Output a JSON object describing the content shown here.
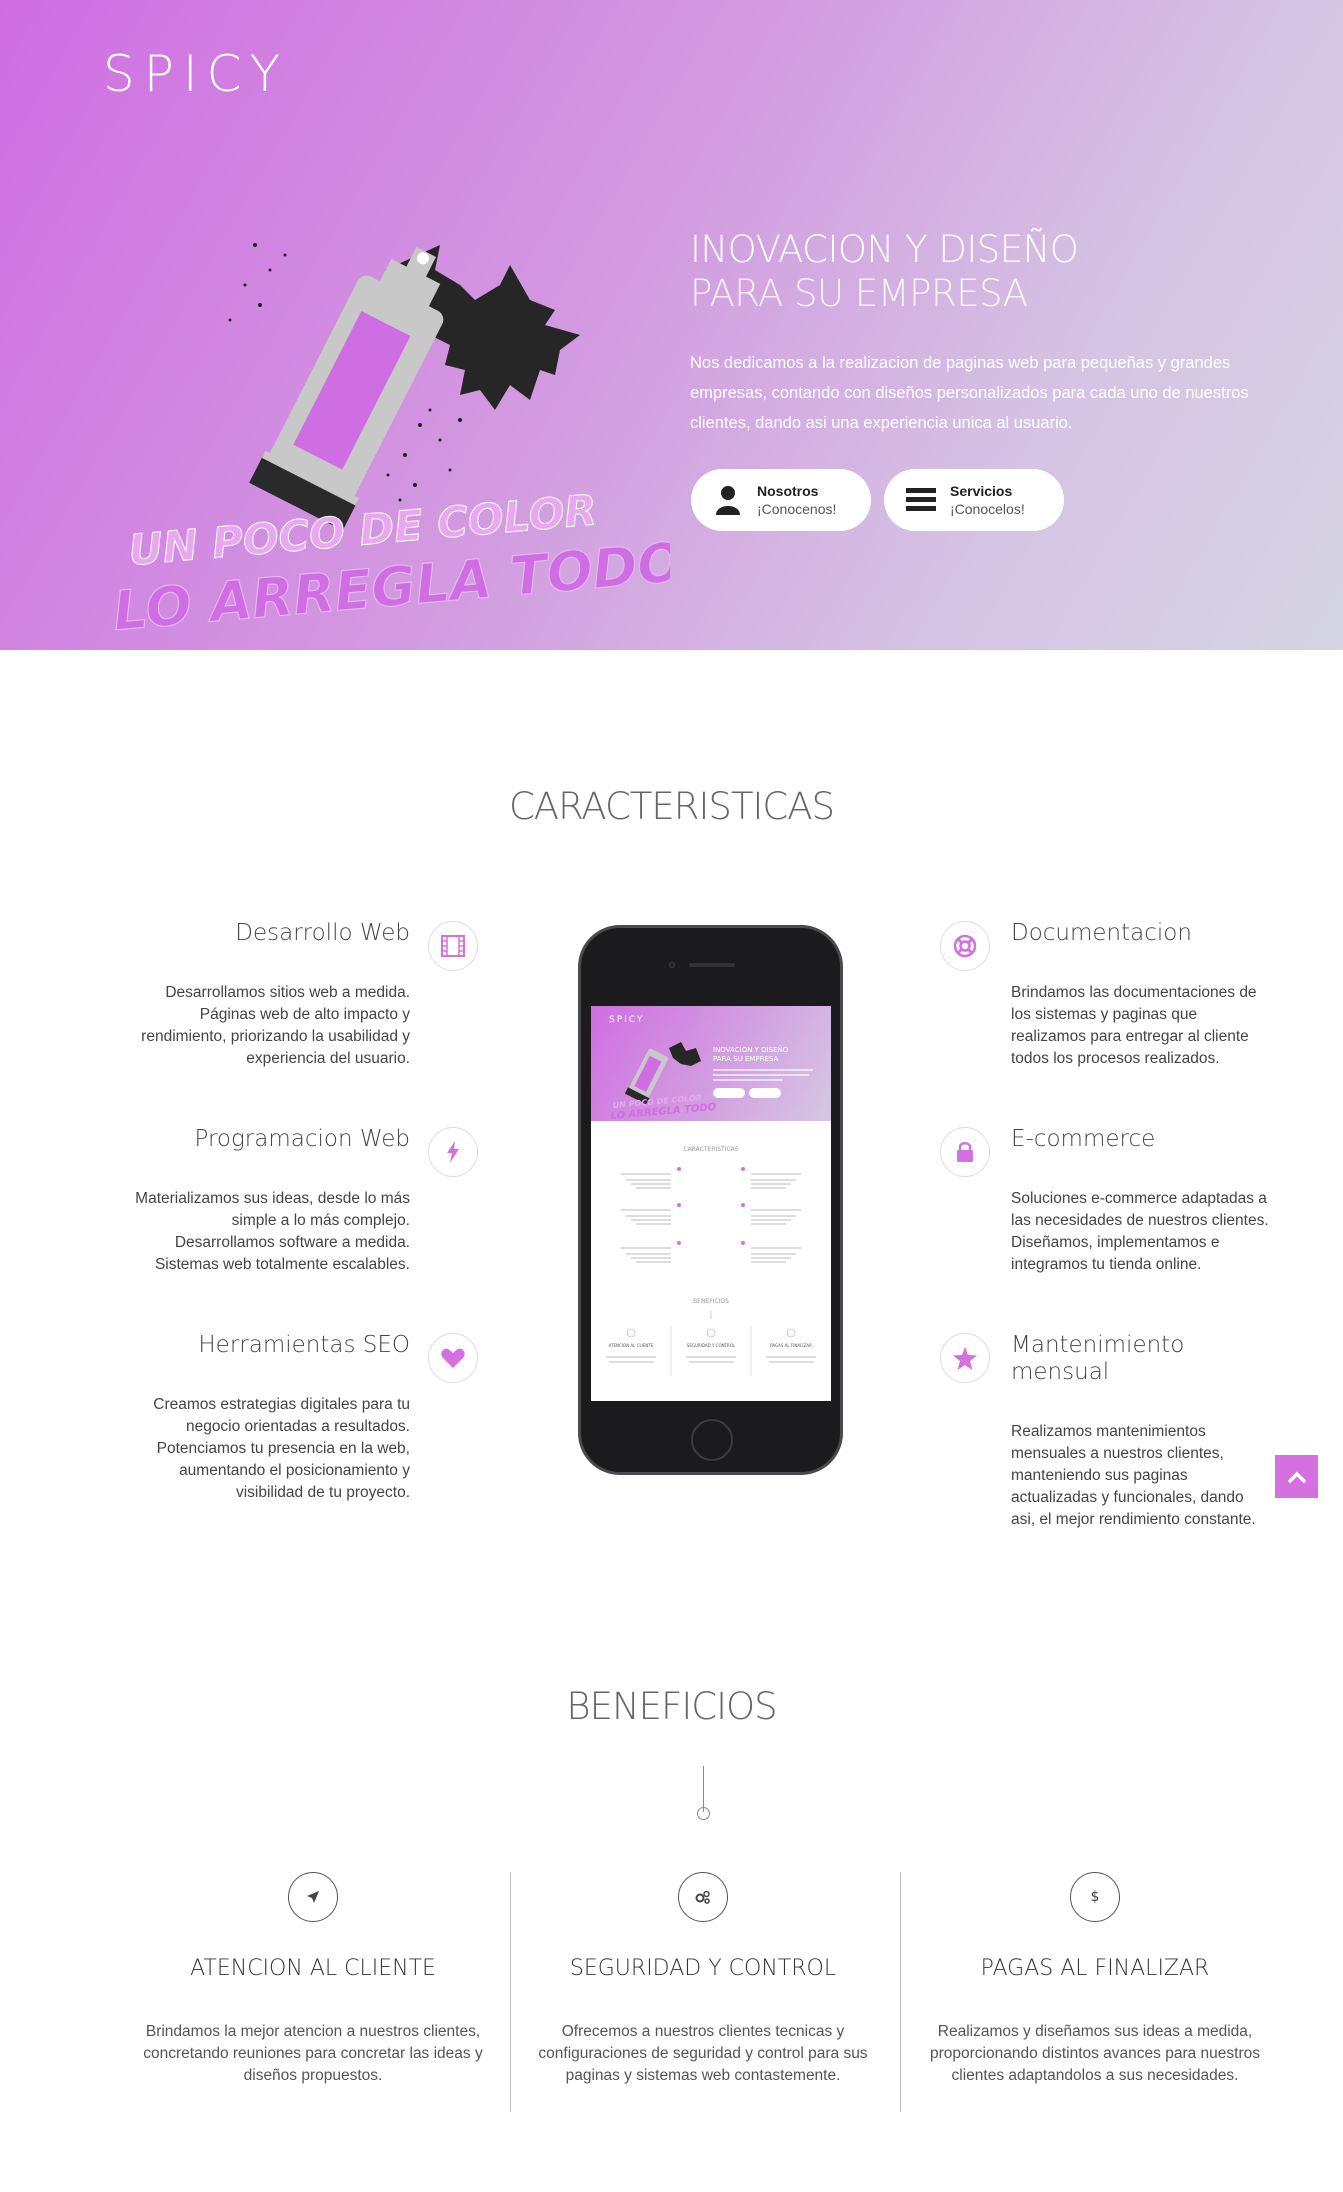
{
  "brand": "SPICY",
  "hero": {
    "title_line1": "INOVACION Y DISEÑO",
    "title_line2": "PARA SU EMPRESA",
    "description": "Nos dedicamos a la realizacion de paginas web para pequeñas y grandes empresas, contando con diseños personalizados para cada uno de nuestros clientes, dando asi una experiencia unica al usuario.",
    "art_line1": "UN POCO DE COLOR",
    "art_line2": "LO ARREGLA TODO",
    "buttons": [
      {
        "label": "Nosotros",
        "sublabel": "¡Conocenos!",
        "icon": "user-icon"
      },
      {
        "label": "Servicios",
        "sublabel": "¡Conocelos!",
        "icon": "menu-icon"
      }
    ]
  },
  "features": {
    "title": "CARACTERISTICAS",
    "left": [
      {
        "title": "Desarrollo Web",
        "text": "Desarrollamos sitios web a medida. Páginas web de alto impacto y rendimiento, priorizando la usabilidad y experiencia del usuario.",
        "icon": "film-icon"
      },
      {
        "title": "Programacion Web",
        "text": "Materializamos sus ideas, desde lo más simple a lo más complejo. Desarrollamos software a medida. Sistemas web totalmente escalables.",
        "icon": "bolt-icon"
      },
      {
        "title": "Herramientas SEO",
        "text": "Creamos estrategias digitales para tu negocio orientadas a resultados. Potenciamos tu presencia en la web, aumentando el posicionamiento y visibilidad de tu proyecto.",
        "icon": "heart-icon"
      }
    ],
    "right": [
      {
        "title": "Documentacion",
        "text": "Brindamos las documentaciones de los sistemas y paginas que realizamos para entregar al cliente todos los procesos realizados.",
        "icon": "lifebuoy-icon"
      },
      {
        "title": "E-commerce",
        "text": "Soluciones e-commerce adaptadas a las necesidades de nuestros clientes. Diseñamos, implementamos e integramos tu tienda online.",
        "icon": "lock-icon"
      },
      {
        "title": "Mantenimiento mensual",
        "text": "Realizamos mantenimientos mensuales a nuestros clientes, manteniendo sus paginas actualizadas y funcionales, dando asi, el mejor rendimiento constante.",
        "icon": "star-icon"
      }
    ]
  },
  "benefits": {
    "title": "BENEFICIOS",
    "items": [
      {
        "title": "ATENCION AL CLIENTE",
        "text": "Brindamos la mejor atencion a nuestros clientes, concretando reuniones para concretar las ideas y diseños propuestos.",
        "icon": "rocket-icon"
      },
      {
        "title": "SEGURIDAD Y CONTROL",
        "text": "Ofrecemos a nuestros clientes tecnicas y configuraciones de seguridad y control para sus paginas y sistemas web contastemente.",
        "icon": "gears-icon"
      },
      {
        "title": "PAGAS AL FINALIZAR",
        "text": "Realizamos y diseñamos sus ideas a medida, proporcionando distintos avances para nuestros clientes adaptandolos a sus necesidades.",
        "icon": "dollar-icon"
      }
    ]
  },
  "colors": {
    "accent": "#d470e0",
    "hero_start": "#cf6ee2",
    "hero_end": "#d5d5e3"
  }
}
